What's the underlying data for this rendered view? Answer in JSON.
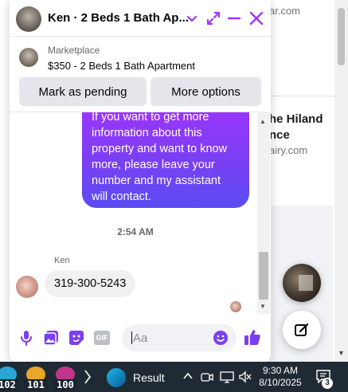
{
  "background_page": {
    "domain_top": "ar.com",
    "title_line1": "he Hiland",
    "title_line2": "nce",
    "domain_second": "airy.com"
  },
  "chat": {
    "header": {
      "title": "Ken · 2 Beds 1 Bath Ap...",
      "chevron_icon": "chevron-down-icon",
      "expand_icon": "expand-icon",
      "minimize_icon": "minimize-icon",
      "close_icon": "close-icon",
      "accent_color": "#a033ff"
    },
    "marketplace": {
      "label": "Marketplace",
      "listing": "$350 - 2 Beds 1 Bath Apartment"
    },
    "actions": {
      "mark_pending": "Mark as pending",
      "more_options": "More options"
    },
    "messages": {
      "outgoing_text": "If you want to get more information about this property and want to know more, please leave your number and my assistant will contact.",
      "timestamp": "2:54 AM",
      "sender_name": "Ken",
      "incoming_text": "319-300-5243"
    },
    "composer": {
      "placeholder": "Aa",
      "icons": [
        "microphone-icon",
        "photo-icon",
        "sticker-icon",
        "gif-icon",
        "emoji-icon",
        "like-icon"
      ],
      "gif_label": "GIF"
    }
  },
  "taskbar": {
    "scores": [
      "102",
      "101",
      "100"
    ],
    "result_label": "Result",
    "time": "9:30 AM",
    "date": "8/10/2025",
    "notification_count": "3"
  }
}
